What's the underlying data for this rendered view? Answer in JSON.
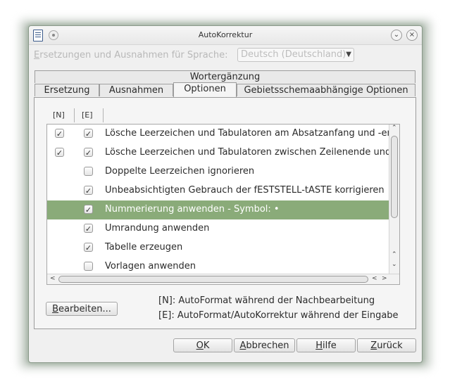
{
  "window": {
    "title": "AutoKorrektur",
    "minimize_symbol": "⌄",
    "close_symbol": "×"
  },
  "language": {
    "label_prefix": "E",
    "label_rest": "rsetzungen und Ausnahmen für Sprache:",
    "selected": "Deutsch (Deutschland)"
  },
  "tabs": {
    "top": [
      {
        "label": "Wortergänzung"
      }
    ],
    "bottom": [
      {
        "label": "Ersetzung"
      },
      {
        "label": "Ausnahmen"
      },
      {
        "label": "Optionen",
        "active": true
      },
      {
        "label": "Gebietsschemaabhängige Optionen"
      }
    ]
  },
  "columns": {
    "n": "[N]",
    "e": "[E]"
  },
  "options": [
    {
      "label": "Lösche Leerzeichen und Tabulatoren am Absatzanfang und -ende",
      "n": true,
      "e": true
    },
    {
      "label": "Lösche Leerzeichen und Tabulatoren zwischen Zeilenende und -anfang",
      "n": true,
      "e": true
    },
    {
      "label": "Doppelte Leerzeichen ignorieren",
      "n": null,
      "e": false
    },
    {
      "label": "Unbeabsichtigten Gebrauch der fESTSTELL-tASTE korrigieren",
      "n": null,
      "e": true
    },
    {
      "label": "Nummerierung anwenden - Symbol: •",
      "n": null,
      "e": true,
      "selected": true
    },
    {
      "label": "Umrandung anwenden",
      "n": null,
      "e": true
    },
    {
      "label": "Tabelle erzeugen",
      "n": null,
      "e": true
    },
    {
      "label": "Vorlagen anwenden",
      "n": null,
      "e": false
    }
  ],
  "scroll_arrows": {
    "up": "⌃",
    "down": "⌄",
    "left": "<",
    "right": ">"
  },
  "edit_button": {
    "mnemonic": "B",
    "rest": "earbeiten..."
  },
  "legend": {
    "n": "[N]: AutoFormat während der Nachbearbeitung",
    "e": "[E]: AutoFormat/AutoKorrektur während der Eingabe"
  },
  "buttons": {
    "ok": {
      "mnemonic": "O",
      "rest": "K"
    },
    "cancel": {
      "mnemonic": "A",
      "rest": "bbrechen"
    },
    "help": {
      "mnemonic": "H",
      "rest": "ilfe"
    },
    "reset": {
      "mnemonic": "Z",
      "rest": "urück"
    }
  },
  "check_mark": "✓",
  "colors": {
    "selection": "#8aab79",
    "window_glow": "#5a785a"
  }
}
